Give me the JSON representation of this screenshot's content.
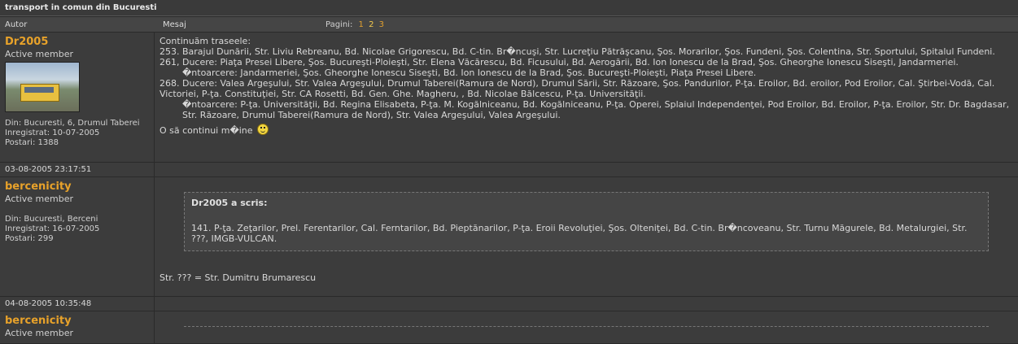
{
  "topic_title": "transport in comun din Bucuresti",
  "header": {
    "col_author": "Autor",
    "col_message": "Mesaj",
    "pages_label": "Pagini:",
    "pages": [
      "1",
      "2",
      "3"
    ]
  },
  "posts": [
    {
      "username": "Dr2005",
      "rank": "Active member",
      "location": "Din: Bucuresti, 6, Drumul Taberei",
      "registered": "Inregistrat: 10-07-2005",
      "posts_count": "Postari: 1388",
      "lines": [
        "Continuăm traseele:",
        "253. Barajul Dunării, Str. Liviu Rebreanu, Bd. Nicolae Grigorescu, Bd. C-tin. Br�ncuşi, Str. Lucreţiu Pătrăşcanu, Şos. Morarilor, Şos. Fundeni, Şos. Colentina, Str. Sportului, Spitalul Fundeni.",
        "261, Ducere: Piaţa Presei Libere, Şos. Bucureşti-Ploieşti, Str. Elena Văcărescu, Bd. Ficusului, Bd. Aerogării, Bd. Ion Ionescu de la Brad, Şos. Gheorghe Ionescu Siseşti, Jandarmeriei.",
        "�ntoarcere: Jandarmeriei, Şos. Gheorghe Ionescu Siseşti, Bd. Ion Ionescu de la Brad, Şos. Bucureşti-Ploieşti, Piaţa Presei Libere.",
        "268. Ducere: Valea Argeşului, Str. Valea Argeşului, Drumul Taberei(Ramura de Nord), Drumul Sării, Str. Răzoare, Şos. Pandurilor, P-ţa. Eroilor, Bd. eroilor, Pod Eroilor, Cal. Ştirbei-Vodă, Cal. Victoriei, P-ţa. Constituţiei, Str. CA Rosetti, Bd. Gen. Ghe. Magheru, , Bd. Nicolae Bălcescu, P-ţa. Universităţii.",
        "�ntoarcere: P-ţa. Universităţii, Bd. Regina Elisabeta, P-ţa. M. Kogălniceanu, Bd. Kogălniceanu, P-ţa. Operei, Splaiul Independenţei, Pod Eroilor, Bd. Eroilor, P-ţa. Eroilor, Str. Dr. Bagdasar, Str. Răzoare, Drumul Taberei(Ramura de Nord), Str. Valea Argeşului, Valea Argeşului.",
        "O să continui m�ine"
      ],
      "date": "03-08-2005 23:17:51"
    },
    {
      "username": "bercenicity",
      "rank": "Active member",
      "location": "Din: Bucuresti, Berceni",
      "registered": "Inregistrat: 16-07-2005",
      "posts_count": "Postari: 299",
      "quote_author": "Dr2005 a scris:",
      "quote_text": "141. P-ţa. Zeţarilor, Prel. Ferentarilor, Cal. Ferntarilor, Bd. Pieptănarilor, P-ţa. Eroii Revoluţiei, Şos. Olteniţei, Bd. C-tin. Br�ncoveanu, Str. Turnu Măgurele, Bd. Metalurgiei, Str. ???, IMGB-VULCAN.",
      "text": "Str. ??? = Str. Dumitru Brumarescu",
      "date": "04-08-2005 10:35:48"
    },
    {
      "username": "bercenicity",
      "rank": "Active member"
    }
  ]
}
